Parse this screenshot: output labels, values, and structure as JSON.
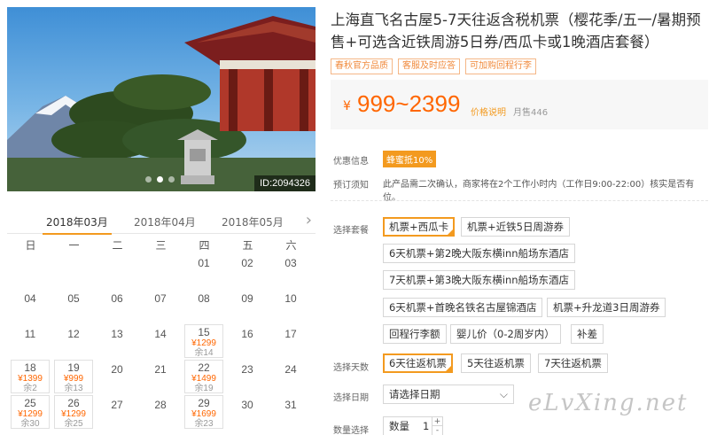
{
  "hero": {
    "image_id": "ID:2094326",
    "slide_count": 3,
    "active_slide": 1
  },
  "product": {
    "title": "上海直飞名古屋5-7天往返含税机票（樱花季/五一/暑期预售+可选含近铁周游5日券/西瓜卡或1晚酒店套餐）",
    "tags": [
      "春秋官方品质",
      "客服及时应答",
      "可加购回程行李"
    ],
    "price_symbol": "¥",
    "price_range": "999~2399",
    "price_explain": "价格说明",
    "monthly_sales": "月售446"
  },
  "info": {
    "promo_label": "优惠信息",
    "promo_badge": "蜂蜜抵10%",
    "notice_label": "预订须知",
    "notice_text": "此产品需二次确认，商家将在2个工作小时内（工作日9:00-22:00）核实是否有位。"
  },
  "package": {
    "label": "选择套餐",
    "options": [
      "机票+西瓜卡",
      "机票+近铁5日周游券",
      "6天机票+第2晚大阪东横inn船场东酒店",
      "7天机票+第3晚大阪东横inn船场东酒店",
      "6天机票+首晚名铁名古屋锦酒店",
      "机票+升龙道3日周游券",
      "回程行李额",
      "婴儿价（0-2周岁内）",
      "补差"
    ],
    "selected": 0
  },
  "days": {
    "label": "选择天数",
    "options": [
      "6天往返机票",
      "5天往返机票",
      "7天往返机票"
    ],
    "selected": 0
  },
  "date_select": {
    "label": "选择日期",
    "placeholder": "请选择日期"
  },
  "quantity": {
    "label": "数量选择",
    "field_label": "数量",
    "value": "1"
  },
  "calendar": {
    "months": [
      "2018年03月",
      "2018年04月",
      "2018年05月"
    ],
    "active_month": 0,
    "weekdays": [
      "日",
      "一",
      "二",
      "三",
      "四",
      "五",
      "六"
    ],
    "first_weekday": 4,
    "days_in_month": 31,
    "available": {
      "15": {
        "price": "¥1299",
        "left": "余14"
      },
      "18": {
        "price": "¥1399",
        "left": "余2"
      },
      "19": {
        "price": "¥999",
        "left": "余13"
      },
      "22": {
        "price": "¥1499",
        "left": "余19"
      },
      "25": {
        "price": "¥1299",
        "left": "余30"
      },
      "26": {
        "price": "¥1299",
        "left": "余25"
      },
      "29": {
        "price": "¥1699",
        "left": "余23"
      }
    }
  },
  "watermark": "eLvXing.net",
  "colors": {
    "accent": "#f39a1f",
    "price": "#ff6600",
    "tag_border": "#f5b787"
  }
}
